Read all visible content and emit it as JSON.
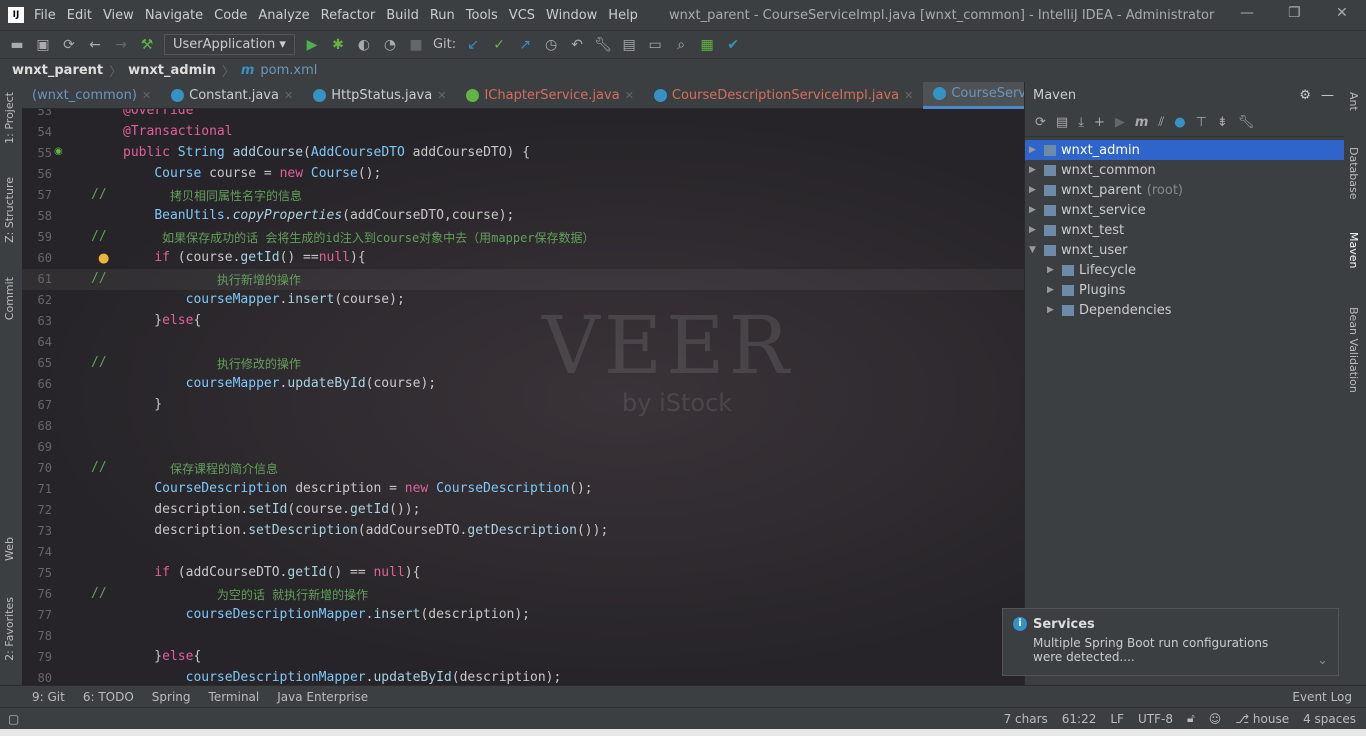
{
  "menubar": {
    "items": [
      "File",
      "Edit",
      "View",
      "Navigate",
      "Code",
      "Analyze",
      "Refactor",
      "Build",
      "Run",
      "Tools",
      "VCS",
      "Window",
      "Help"
    ],
    "title": "wnxt_parent - CourseServiceImpl.java [wnxt_common] - IntelliJ IDEA - Administrator"
  },
  "toolbar": {
    "run_config": "UserApplication",
    "git_label": "Git:"
  },
  "breadcrumb": [
    "wnxt_parent",
    "wnxt_admin",
    "pom.xml"
  ],
  "tabs": [
    {
      "label": "(wnxt_common)",
      "icon": "none",
      "style": "dim"
    },
    {
      "label": "Constant.java",
      "icon": "class"
    },
    {
      "label": "HttpStatus.java",
      "icon": "class"
    },
    {
      "label": "IChapterService.java",
      "icon": "interface",
      "style": "red"
    },
    {
      "label": "CourseDescriptionServiceImpl.java",
      "icon": "class",
      "style": "red"
    },
    {
      "label": "CourseServiceImpl.java",
      "icon": "class",
      "active": true
    }
  ],
  "left_tools": [
    "1: Project",
    "Z: Structure",
    "Commit",
    "Web",
    "2: Favorites"
  ],
  "right_tools": [
    "Ant",
    "Database",
    "Maven",
    "Bean Validation"
  ],
  "editor": {
    "current_line": 61,
    "lines": [
      {
        "n": 53,
        "t": [
          [
            "an",
            "@Override"
          ]
        ]
      },
      {
        "n": 54,
        "t": [
          [
            "an",
            "@Transactional"
          ]
        ]
      },
      {
        "n": 55,
        "t": [
          [
            "kw",
            "public "
          ],
          [
            "ty",
            "String "
          ],
          [
            "fn",
            "addCourse"
          ],
          [
            "",
            "("
          ],
          [
            "ty",
            "AddCourseDTO "
          ],
          [
            "",
            "addCourseDTO) {"
          ]
        ]
      },
      {
        "n": 56,
        "t": [
          [
            "",
            "    "
          ],
          [
            "ty",
            "Course "
          ],
          [
            "",
            "course = "
          ],
          [
            "kw",
            "new "
          ],
          [
            "ty",
            "Course"
          ],
          [
            "",
            "();"
          ]
        ]
      },
      {
        "n": 57,
        "c": "//",
        "t": [
          [
            "",
            "      "
          ],
          [
            "zh",
            "拷贝相同属性名字的信息"
          ]
        ]
      },
      {
        "n": 58,
        "t": [
          [
            "",
            "    "
          ],
          [
            "ty",
            "BeanUtils"
          ],
          [
            "",
            ""
          ],
          [
            "it fn",
            ".copyProperties"
          ],
          [
            "",
            "(addCourseDTO,course);"
          ]
        ]
      },
      {
        "n": 59,
        "c": "//",
        "t": [
          [
            "",
            "     "
          ],
          [
            "zh",
            "如果保存成功的话 会将生成的id注入到course对象中去（用mapper保存数据）"
          ]
        ]
      },
      {
        "n": 60,
        "t": [
          [
            "",
            "    "
          ],
          [
            "kw",
            "if "
          ],
          [
            "",
            "(course."
          ],
          [
            "fn",
            "getId"
          ],
          [
            "",
            "() =="
          ],
          [
            "kw",
            "null"
          ],
          [
            "",
            "){"
          ]
        ]
      },
      {
        "n": 61,
        "c": "//",
        "t": [
          [
            "",
            "            "
          ],
          [
            "zh",
            "执行新增的操作"
          ]
        ]
      },
      {
        "n": 62,
        "t": [
          [
            "",
            "        "
          ],
          [
            "fld",
            "courseMapper"
          ],
          [
            "",
            "."
          ],
          [
            "fn",
            "insert"
          ],
          [
            "",
            "(course);"
          ]
        ]
      },
      {
        "n": 63,
        "t": [
          [
            "",
            "    }"
          ],
          [
            "kw",
            "else"
          ],
          [
            "",
            "{"
          ]
        ]
      },
      {
        "n": 64,
        "t": []
      },
      {
        "n": 65,
        "c": "//",
        "t": [
          [
            "",
            "            "
          ],
          [
            "zh",
            "执行修改的操作"
          ]
        ]
      },
      {
        "n": 66,
        "t": [
          [
            "",
            "        "
          ],
          [
            "fld",
            "courseMapper"
          ],
          [
            "",
            "."
          ],
          [
            "fn",
            "updateById"
          ],
          [
            "",
            "(course);"
          ]
        ]
      },
      {
        "n": 67,
        "t": [
          [
            "",
            "    }"
          ]
        ]
      },
      {
        "n": 68,
        "t": []
      },
      {
        "n": 69,
        "t": []
      },
      {
        "n": 70,
        "c": "//",
        "t": [
          [
            "",
            "      "
          ],
          [
            "zh",
            "保存课程的简介信息"
          ]
        ]
      },
      {
        "n": 71,
        "t": [
          [
            "",
            "    "
          ],
          [
            "ty",
            "CourseDescription "
          ],
          [
            "",
            "description = "
          ],
          [
            "kw",
            "new "
          ],
          [
            "ty",
            "CourseDescription"
          ],
          [
            "",
            "();"
          ]
        ]
      },
      {
        "n": 72,
        "t": [
          [
            "",
            "    description."
          ],
          [
            "fn",
            "setId"
          ],
          [
            "",
            "(course."
          ],
          [
            "fn",
            "getId"
          ],
          [
            "",
            "());"
          ]
        ]
      },
      {
        "n": 73,
        "t": [
          [
            "",
            "    description."
          ],
          [
            "fn",
            "setDescription"
          ],
          [
            "",
            "(addCourseDTO."
          ],
          [
            "fn",
            "getDescription"
          ],
          [
            "",
            "());"
          ]
        ]
      },
      {
        "n": 74,
        "t": []
      },
      {
        "n": 75,
        "t": [
          [
            "",
            "    "
          ],
          [
            "kw",
            "if "
          ],
          [
            "",
            "(addCourseDTO."
          ],
          [
            "fn",
            "getId"
          ],
          [
            "",
            "() == "
          ],
          [
            "kw",
            "null"
          ],
          [
            "",
            "){"
          ]
        ]
      },
      {
        "n": 76,
        "c": "//",
        "t": [
          [
            "",
            "            "
          ],
          [
            "zh",
            "为空的话 就执行新增的操作"
          ]
        ]
      },
      {
        "n": 77,
        "t": [
          [
            "",
            "        "
          ],
          [
            "fld",
            "courseDescriptionMapper"
          ],
          [
            "",
            "."
          ],
          [
            "fn",
            "insert"
          ],
          [
            "",
            "(description);"
          ]
        ]
      },
      {
        "n": 78,
        "t": []
      },
      {
        "n": 79,
        "t": [
          [
            "",
            "    }"
          ],
          [
            "kw",
            "else"
          ],
          [
            "",
            "{"
          ]
        ]
      },
      {
        "n": 80,
        "t": [
          [
            "",
            "        "
          ],
          [
            "fld",
            "courseDescriptionMapper"
          ],
          [
            "",
            "."
          ],
          [
            "fn",
            "updateById"
          ],
          [
            "",
            "(description);"
          ]
        ]
      }
    ],
    "watermark": "VEER",
    "watermark_sub": "by iStock"
  },
  "maven": {
    "title": "Maven",
    "tree": [
      {
        "label": "wnxt_admin",
        "level": 0,
        "arrow": "▶",
        "selected": true
      },
      {
        "label": "wnxt_common",
        "level": 0,
        "arrow": "▶"
      },
      {
        "label": "wnxt_parent",
        "suffix": "(root)",
        "level": 0,
        "arrow": "▶"
      },
      {
        "label": "wnxt_service",
        "level": 0,
        "arrow": "▶"
      },
      {
        "label": "wnxt_test",
        "level": 0,
        "arrow": "▶"
      },
      {
        "label": "wnxt_user",
        "level": 0,
        "arrow": "▼"
      },
      {
        "label": "Lifecycle",
        "level": 1,
        "arrow": "▶"
      },
      {
        "label": "Plugins",
        "level": 1,
        "arrow": "▶"
      },
      {
        "label": "Dependencies",
        "level": 1,
        "arrow": "▶"
      }
    ]
  },
  "notification": {
    "title": "Services",
    "body": "Multiple Spring Boot run configurations were detected...."
  },
  "toolwindows": [
    "9: Git",
    "6: TODO",
    "Spring",
    "Terminal",
    "Java Enterprise"
  ],
  "event_log": "Event Log",
  "status": [
    "7 chars",
    "61:22",
    "LF",
    "UTF-8",
    "house",
    "4 spaces"
  ],
  "colors": {
    "accent": "#2f65ca",
    "keyword": "#e0609a",
    "comment": "#62a05a"
  }
}
